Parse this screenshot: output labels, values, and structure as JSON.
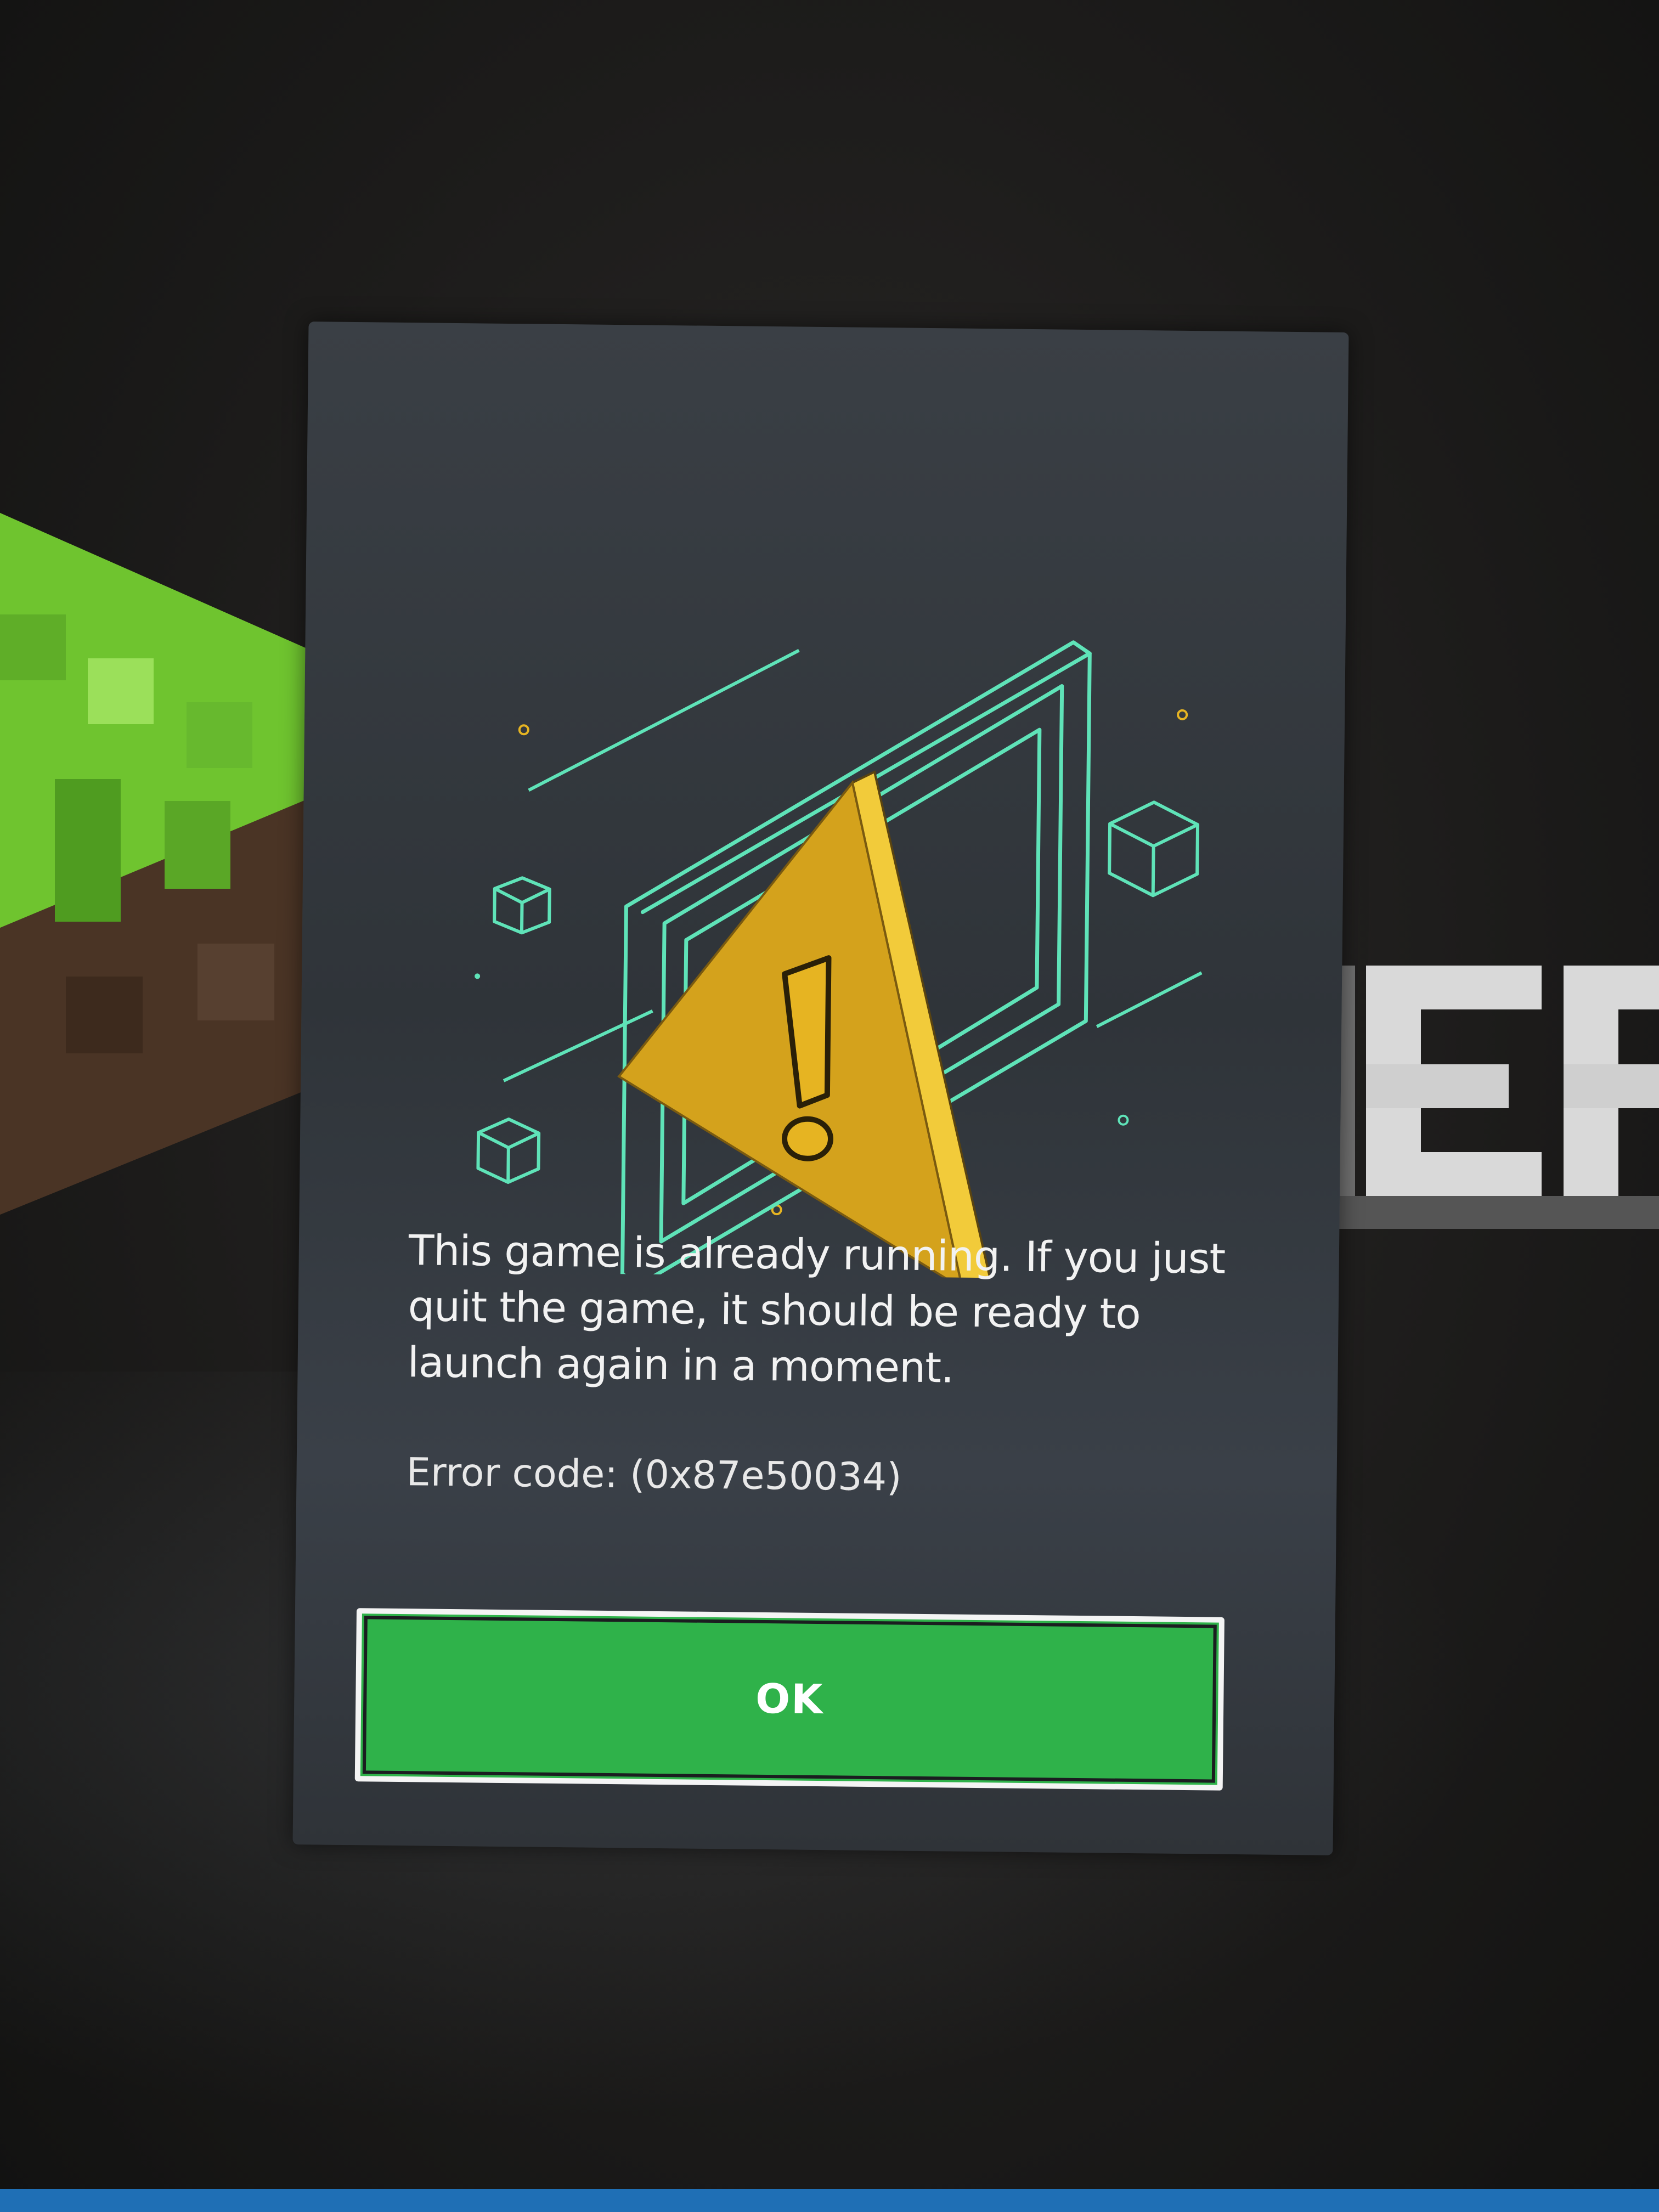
{
  "dialog": {
    "message": "This game is already running. If you just quit the game, it should be ready to launch again in a moment.",
    "error_code": "Error code: (0x87e50034)",
    "ok_label": "OK",
    "illustration_icon": "warning-triangle-icon"
  },
  "colors": {
    "dialog_bg": "#33383d",
    "button_green": "#2fb24a",
    "illustration_teal": "#5fe3b8",
    "warning_yellow": "#e6b422",
    "text": "#f2f2f2"
  }
}
